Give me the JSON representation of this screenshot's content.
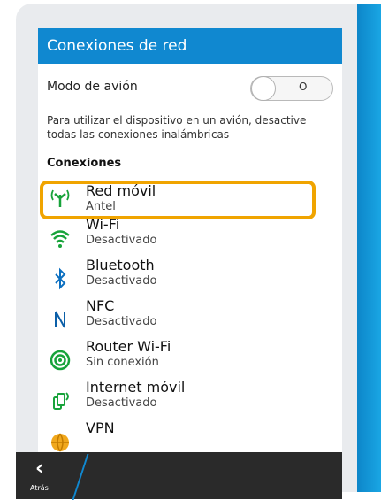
{
  "header": {
    "title": "Conexiones de red"
  },
  "airplane": {
    "label": "Modo de avión",
    "toggle_state": "O"
  },
  "description": "Para utilizar el dispositivo en un avión, desactive todas las conexiones inalámbricas",
  "section": {
    "title": "Conexiones"
  },
  "items": [
    {
      "name": "Red móvil",
      "status": "Antel",
      "icon": "antenna-icon"
    },
    {
      "name": "Wi-Fi",
      "status": "Desactivado",
      "icon": "wifi-icon"
    },
    {
      "name": "Bluetooth",
      "status": "Desactivado",
      "icon": "bluetooth-icon"
    },
    {
      "name": "NFC",
      "status": "Desactivado",
      "icon": "nfc-icon"
    },
    {
      "name": "Router Wi-Fi",
      "status": "Sin conexión",
      "icon": "hotspot-icon"
    },
    {
      "name": "Internet móvil",
      "status": "Desactivado",
      "icon": "tethering-icon"
    },
    {
      "name": "VPN",
      "status": "",
      "icon": "vpn-globe-icon"
    }
  ],
  "bottom": {
    "back_label": "Atrás"
  },
  "colors": {
    "accent": "#1088d0",
    "highlight": "#f0a400",
    "bar": "#2a2a2a"
  }
}
